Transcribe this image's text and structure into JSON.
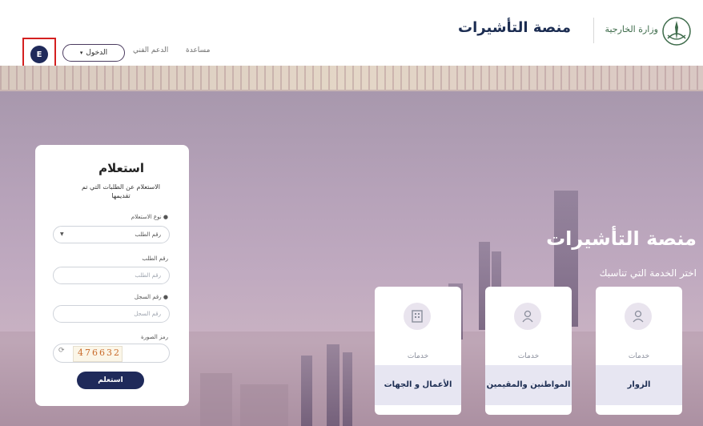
{
  "header": {
    "lang_label": "E",
    "login_label": "الدخول",
    "support_link": "الدعم الفني",
    "help_link": "مساعدة",
    "platform_title": "منصة التأشيرات",
    "ministry_name": "وزارة الخارجية"
  },
  "hero": {
    "title": "منصة التأشيرات",
    "subtitle": "اختر الخدمة التي تناسبك"
  },
  "services": [
    {
      "caption": "خدمات",
      "name": "الأعمال و الجهات",
      "icon": "building-icon"
    },
    {
      "caption": "خدمات",
      "name": "المواطنين والمقيمين",
      "icon": "citizen-icon"
    },
    {
      "caption": "خدمات",
      "name": "الزوار",
      "icon": "visitor-icon"
    }
  ],
  "inquiry": {
    "title": "استعلام",
    "description": "الاستعلام عن الطلبات التي تم تقديمها",
    "type_label": "نوع الاستعلام",
    "type_value": "رقم الطلب",
    "request_label": "رقم الطلب",
    "request_placeholder": "رقم الطلب",
    "record_label": "رقم السجل",
    "record_placeholder": "رقم السجل",
    "captcha_label": "رمز الصورة",
    "captcha_text": "476632",
    "submit_label": "استعلم"
  },
  "colors": {
    "primary": "#1f2a5a",
    "highlight": "#d42020"
  }
}
